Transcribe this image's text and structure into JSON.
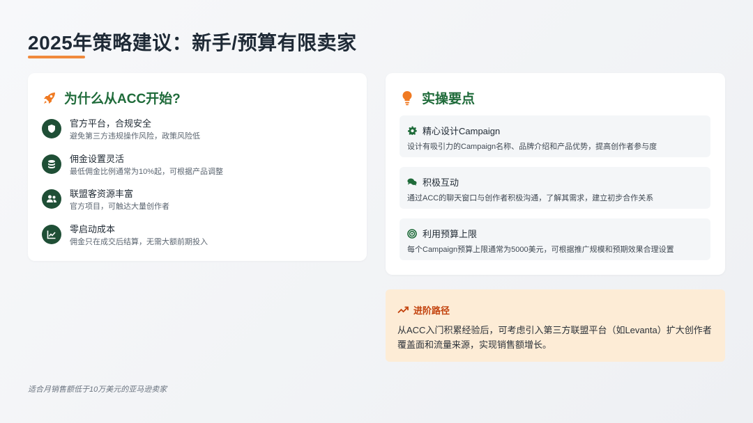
{
  "page": {
    "title": "2025年策略建议：新手/预算有限卖家",
    "footnote": "适合月销售额低于10万美元的亚马逊卖家",
    "accent_color": "#f08a3c",
    "heading_color": "#1f6b3a"
  },
  "why_card": {
    "icon": "rocket-icon",
    "heading": "为什么从ACC开始?",
    "items": [
      {
        "icon": "shield-icon",
        "title": "官方平台，合规安全",
        "desc": "避免第三方违规操作风险，政策风险低"
      },
      {
        "icon": "coins-icon",
        "title": "佣金设置灵活",
        "desc": "最低佣金比例通常为10%起，可根据产品调整"
      },
      {
        "icon": "users-icon",
        "title": "联盟客资源丰富",
        "desc": "官方项目，可触达大量创作者"
      },
      {
        "icon": "chart-line-icon",
        "title": "零启动成本",
        "desc": "佣金只在成交后结算，无需大额前期投入"
      }
    ]
  },
  "tips_card": {
    "icon": "lightbulb-icon",
    "heading": "实操要点",
    "items": [
      {
        "icon": "gear-icon",
        "title": "精心设计Campaign",
        "desc": "设计有吸引力的Campaign名称、品牌介绍和产品优势，提高创作者参与度"
      },
      {
        "icon": "chat-icon",
        "title": "积极互动",
        "desc": "通过ACC的聊天窗口与创作者积极沟通，了解其需求，建立初步合作关系"
      },
      {
        "icon": "target-icon",
        "title": "利用预算上限",
        "desc": "每个Campaign预算上限通常为5000美元，可根据推广规模和预期效果合理设置"
      }
    ]
  },
  "advanced": {
    "icon": "trend-up-icon",
    "heading": "进阶路径",
    "text": "从ACC入门积累经验后，可考虑引入第三方联盟平台（如Levanta）扩大创作者覆盖面和流量来源，实现销售额增长。"
  }
}
